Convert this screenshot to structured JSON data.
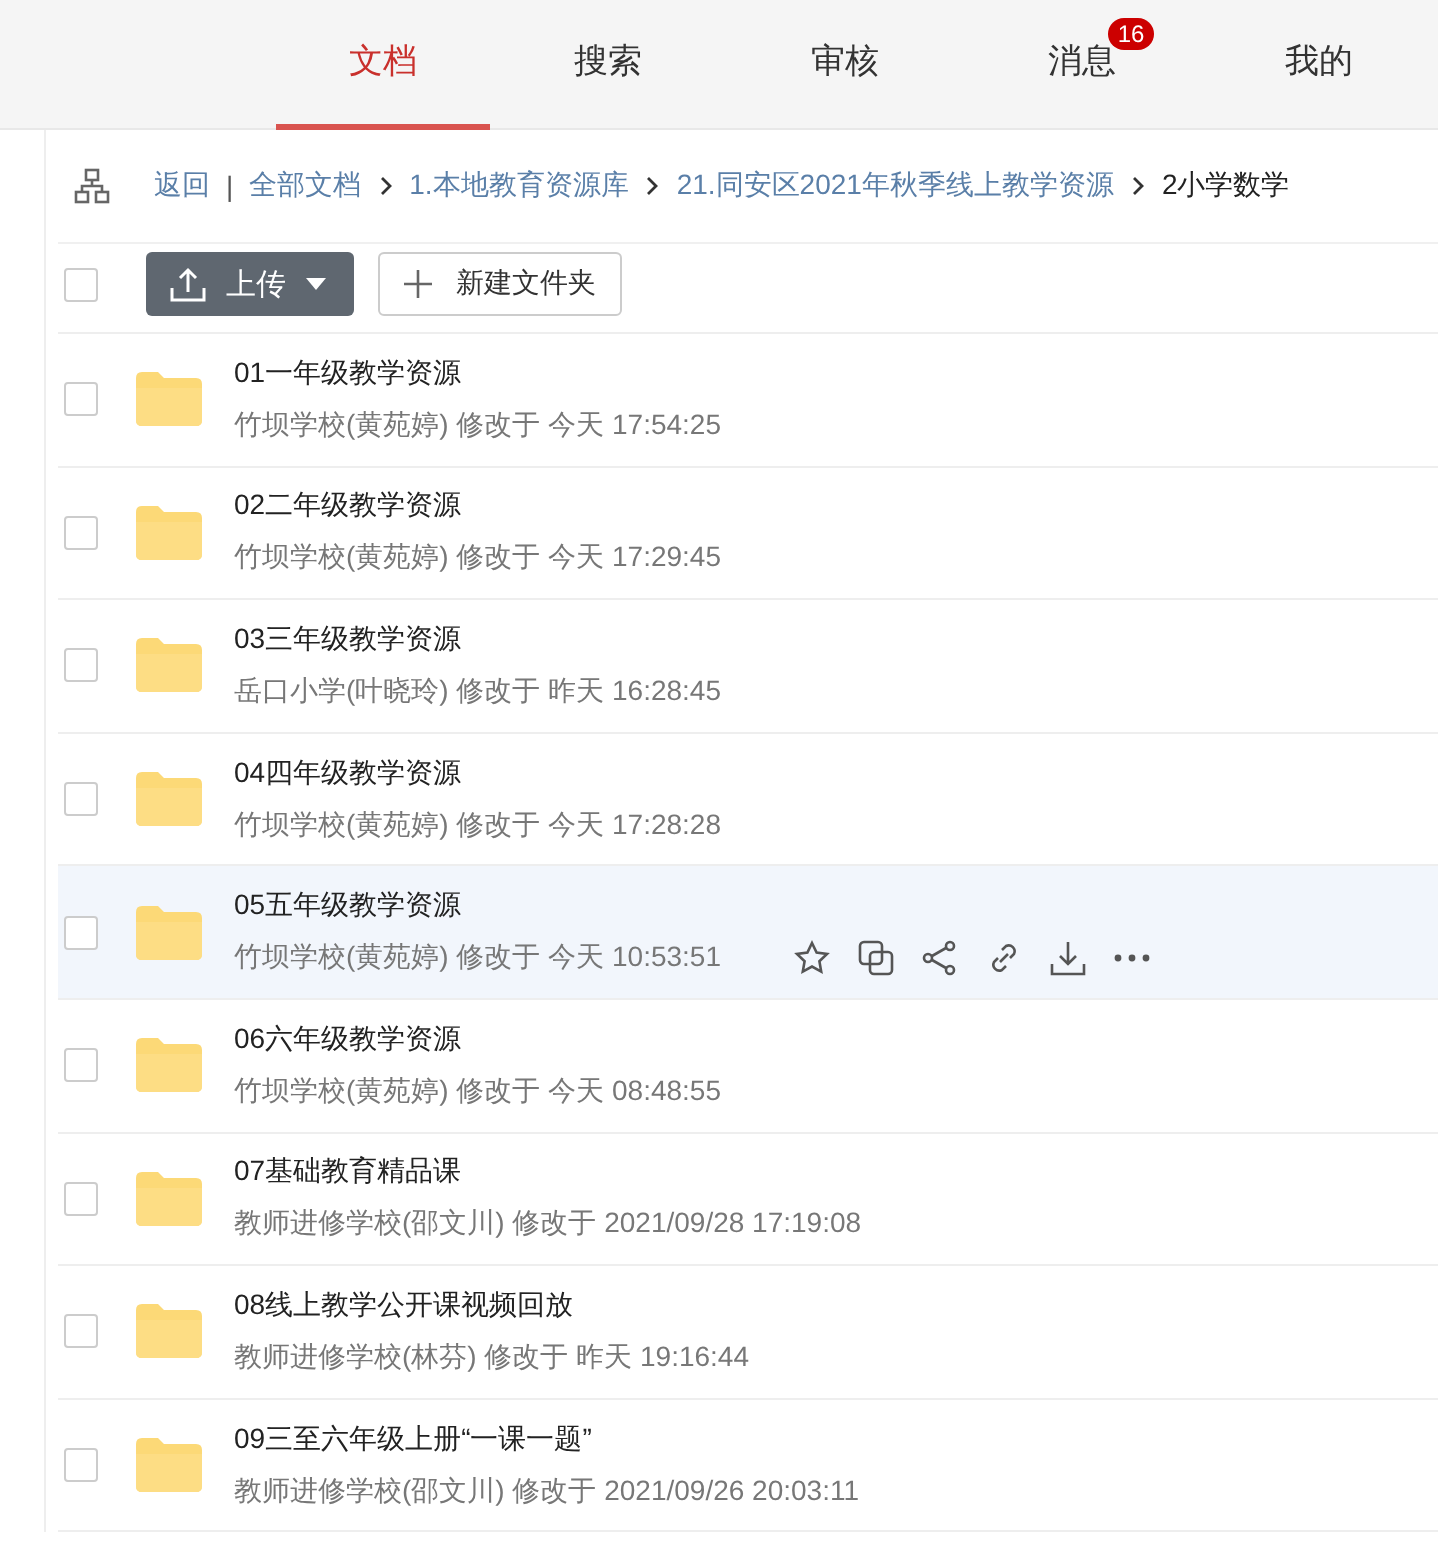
{
  "nav_tabs": [
    {
      "label": "文档",
      "selected": true
    },
    {
      "label": "搜索",
      "selected": false
    },
    {
      "label": "审核",
      "selected": false
    },
    {
      "label": "消息",
      "selected": false,
      "badge": "16"
    },
    {
      "label": "我的",
      "selected": false
    }
  ],
  "breadcrumb": {
    "back": "返回",
    "separator": "|",
    "items": [
      "全部文档",
      "1.本地教育资源库",
      "21.同安区2021年秋季线上教学资源",
      "2小学数学"
    ]
  },
  "toolbar": {
    "select_all_checked": false,
    "upload": "上传",
    "new_folder": "新建文件夹"
  },
  "rows": [
    {
      "name": "01一年级教学资源",
      "meta": "竹坝学校(黄苑婷) 修改于 今天 17:54:25",
      "checked": false,
      "hovered": false
    },
    {
      "name": "02二年级教学资源",
      "meta": "竹坝学校(黄苑婷) 修改于 今天 17:29:45",
      "checked": false,
      "hovered": false
    },
    {
      "name": "03三年级教学资源",
      "meta": "岳口小学(叶晓玲) 修改于 昨天 16:28:45",
      "checked": false,
      "hovered": false
    },
    {
      "name": "04四年级教学资源",
      "meta": "竹坝学校(黄苑婷) 修改于 今天 17:28:28",
      "checked": false,
      "hovered": false
    },
    {
      "name": "05五年级教学资源",
      "meta": "竹坝学校(黄苑婷) 修改于 今天 10:53:51",
      "checked": false,
      "hovered": true
    },
    {
      "name": "06六年级教学资源",
      "meta": "竹坝学校(黄苑婷) 修改于 今天 08:48:55",
      "checked": false,
      "hovered": false
    },
    {
      "name": "07基础教育精品课",
      "meta": "教师进修学校(邵文川) 修改于 2021/09/28 17:19:08",
      "checked": false,
      "hovered": false
    },
    {
      "name": "08线上教学公开课视频回放",
      "meta": "教师进修学校(林芬) 修改于 昨天 19:16:44",
      "checked": false,
      "hovered": false
    },
    {
      "name": "09三至六年级上册“一课一题”",
      "meta": "教师进修学校(邵文川) 修改于 2021/09/26 20:03:11",
      "checked": false,
      "hovered": false
    }
  ]
}
